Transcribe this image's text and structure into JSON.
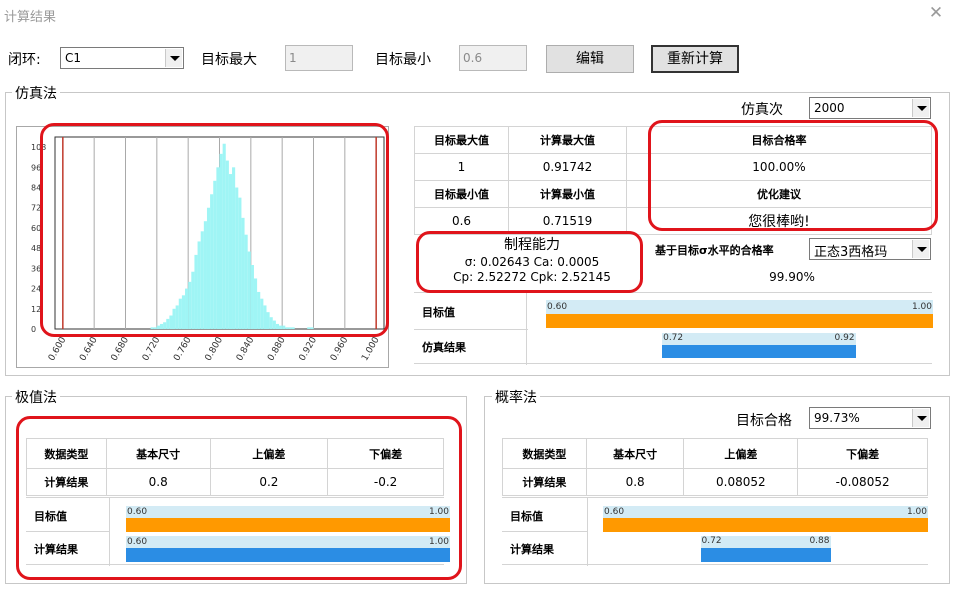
{
  "window": {
    "title": "计算结果",
    "close_glyph": "✕"
  },
  "top": {
    "loop_label": "闭环:",
    "loop_value": "C1",
    "target_max_label": "目标最大",
    "target_max_value": "1",
    "target_min_label": "目标最小",
    "target_min_value": "0.6",
    "edit_button": "编辑",
    "recalc_button": "重新计算"
  },
  "simulation": {
    "title": "仿真法",
    "runs_label": "仿真次",
    "runs_value": "2000",
    "histogram": {
      "y_ticks": [
        "108",
        "96",
        "84",
        "72",
        "60",
        "48",
        "36",
        "24",
        "12",
        "0"
      ],
      "x_ticks": [
        "0.600",
        "0.640",
        "0.680",
        "0.720",
        "0.760",
        "0.800",
        "0.840",
        "0.880",
        "0.920",
        "0.960",
        "1.000"
      ],
      "lower_limit": 0.6,
      "upper_limit": 1.0,
      "x_range": [
        0.59,
        1.01
      ],
      "y_max": 114,
      "bins": [
        0.712,
        0.716,
        0.72,
        0.724,
        0.728,
        0.732,
        0.736,
        0.74,
        0.744,
        0.748,
        0.752,
        0.756,
        0.76,
        0.764,
        0.768,
        0.772,
        0.776,
        0.78,
        0.784,
        0.788,
        0.792,
        0.796,
        0.8,
        0.804,
        0.808,
        0.812,
        0.816,
        0.82,
        0.824,
        0.828,
        0.832,
        0.836,
        0.84,
        0.844,
        0.848,
        0.852,
        0.856,
        0.86,
        0.864,
        0.868,
        0.872,
        0.876,
        0.88,
        0.884,
        0.888,
        0.892,
        0.896,
        0.9,
        0.904,
        0.908,
        0.912,
        0.916
      ],
      "counts": [
        1,
        1,
        2,
        3,
        4,
        6,
        8,
        12,
        14,
        18,
        20,
        24,
        28,
        34,
        44,
        52,
        58,
        64,
        72,
        80,
        88,
        96,
        104,
        110,
        100,
        92,
        96,
        84,
        78,
        66,
        56,
        46,
        38,
        30,
        22,
        18,
        14,
        10,
        7,
        5,
        3,
        2,
        2,
        1,
        1,
        1,
        0,
        0,
        0,
        0,
        1,
        1
      ]
    },
    "table": {
      "h_target_max": "目标最大值",
      "h_calc_max": "计算最大值",
      "h_pass_rate": "目标合格率",
      "target_max": "1",
      "calc_max": "0.91742",
      "pass_rate": "100.00%",
      "h_target_min": "目标最小值",
      "h_calc_min": "计算最小值",
      "h_advice": "优化建议",
      "target_min": "0.6",
      "calc_min": "0.71519",
      "advice": "您很棒哟!",
      "capability_title": "制程能力",
      "capability_line1": "σ: 0.02643 Ca: 0.0005",
      "capability_line2": "Cp: 2.52272 Cpk: 2.52145",
      "sigma_label": "基于目标σ水平的合格率",
      "sigma_value": "正态3西格玛",
      "sigma_rate": "99.90%",
      "target_value_label": "目标值",
      "sim_result_label": "仿真结果"
    },
    "bars": {
      "range": [
        0.6,
        1.0
      ],
      "target": {
        "low": 0.6,
        "high": 1.0,
        "low_label": "0.60",
        "high_label": "1.00"
      },
      "result": {
        "low": 0.72,
        "high": 0.92,
        "low_label": "0.72",
        "high_label": "0.92"
      }
    }
  },
  "extreme": {
    "title": "极值法",
    "headers": [
      "数据类型",
      "基本尺寸",
      "上偏差",
      "下偏差"
    ],
    "row": [
      "计算结果",
      "0.8",
      "0.2",
      "-0.2"
    ],
    "target_label": "目标值",
    "result_label": "计算结果",
    "bars": {
      "range": [
        0.6,
        1.0
      ],
      "target": {
        "low": 0.6,
        "high": 1.0,
        "low_label": "0.60",
        "high_label": "1.00"
      },
      "result": {
        "low": 0.6,
        "high": 1.0,
        "low_label": "0.60",
        "high_label": "1.00"
      }
    }
  },
  "probability": {
    "title": "概率法",
    "pass_label": "目标合格",
    "pass_value": "99.73%",
    "headers": [
      "数据类型",
      "基本尺寸",
      "上偏差",
      "下偏差"
    ],
    "row": [
      "计算结果",
      "0.8",
      "0.08052",
      "-0.08052"
    ],
    "target_label": "目标值",
    "result_label": "计算结果",
    "bars": {
      "range": [
        0.6,
        1.0
      ],
      "target": {
        "low": 0.6,
        "high": 1.0,
        "low_label": "0.60",
        "high_label": "1.00"
      },
      "result": {
        "low": 0.72,
        "high": 0.88,
        "low_label": "0.72",
        "high_label": "0.88"
      }
    }
  },
  "colors": {
    "histogram_fill": "#9ff5f5",
    "limit_line": "#c0392b",
    "target_bar": "#ff9900",
    "result_bar": "#2b8de4",
    "bar_background": "#d3ebf5",
    "annotation_ring": "#e0141b"
  }
}
